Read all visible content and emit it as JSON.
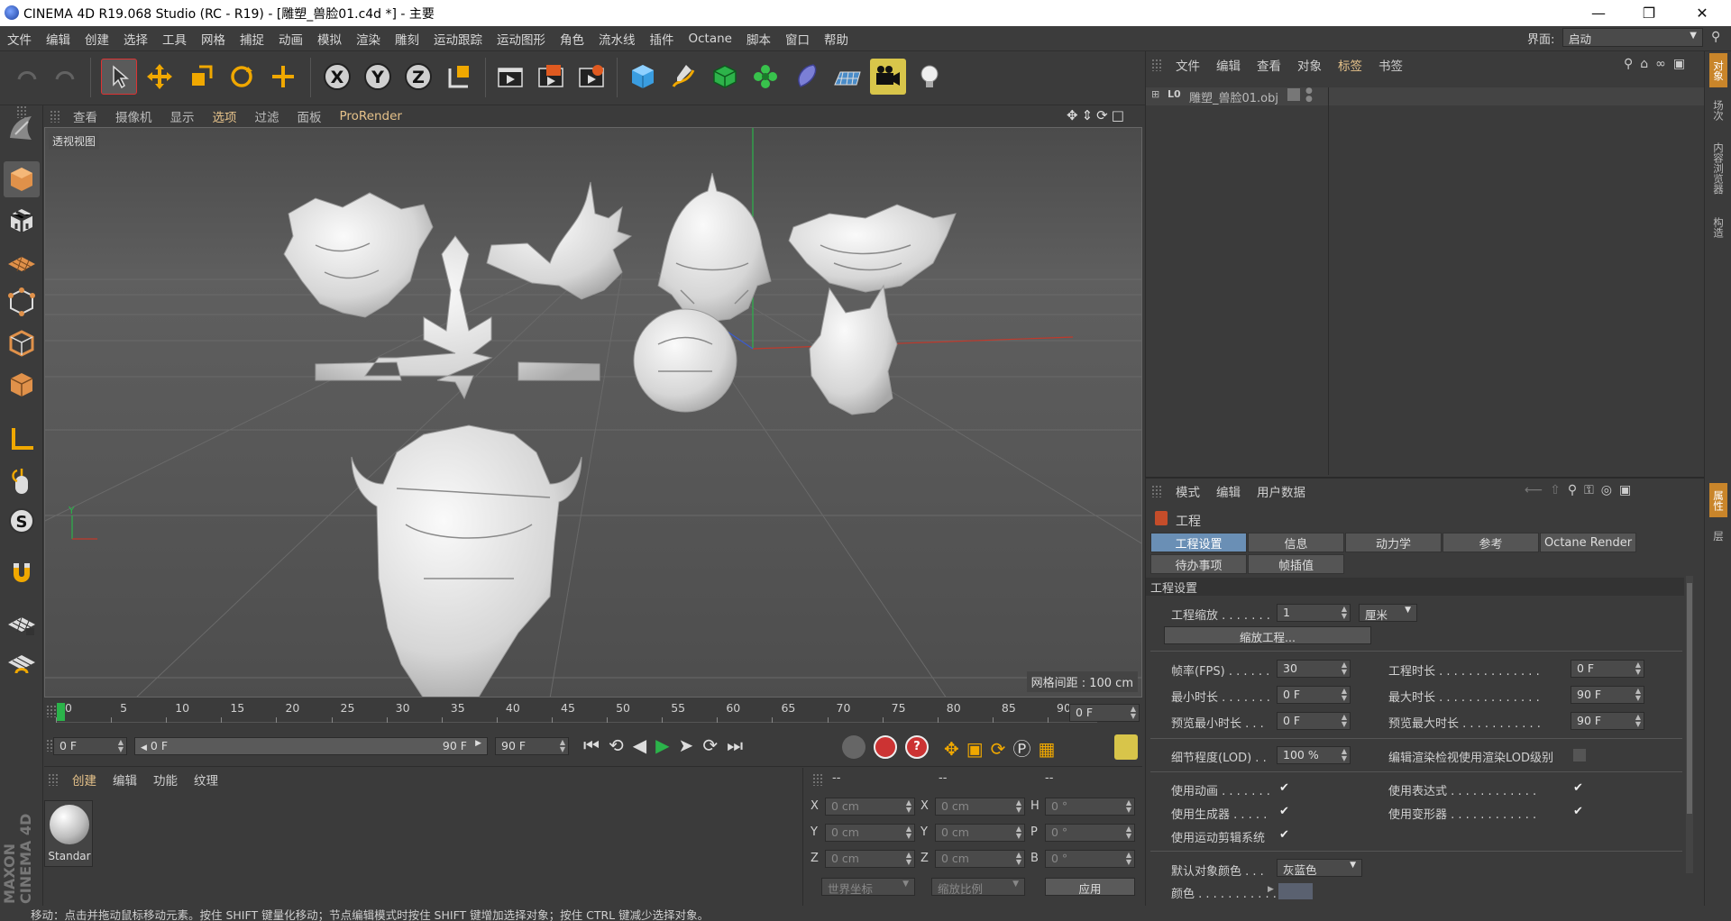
{
  "window": {
    "title": "CINEMA 4D R19.068 Studio (RC - R19) - [雕塑_兽脸01.c4d *] - 主要"
  },
  "menubar": {
    "items": [
      "文件",
      "编辑",
      "创建",
      "选择",
      "工具",
      "网格",
      "捕捉",
      "动画",
      "模拟",
      "渲染",
      "雕刻",
      "运动跟踪",
      "运动图形",
      "角色",
      "流水线",
      "插件",
      "Octane",
      "脚本",
      "窗口",
      "帮助"
    ],
    "layout_label": "界面:",
    "layout_value": "启动"
  },
  "viewport": {
    "menu": [
      "查看",
      "摄像机",
      "显示",
      "选项",
      "过滤",
      "面板",
      "ProRender"
    ],
    "label": "透视视图",
    "grid_note": "网格间距 : 100 cm"
  },
  "timeline": {
    "ticks": [
      "0",
      "5",
      "10",
      "15",
      "20",
      "25",
      "30",
      "35",
      "40",
      "45",
      "50",
      "55",
      "60",
      "65",
      "70",
      "75",
      "80",
      "85",
      "90"
    ],
    "current_frame": "0 F"
  },
  "transport": {
    "start": "0 F",
    "range_start": "0 F",
    "range_end": "90 F",
    "end": "90 F"
  },
  "materials": {
    "menu": [
      "创建",
      "编辑",
      "功能",
      "纹理"
    ],
    "items": [
      {
        "name": "Standar"
      }
    ]
  },
  "coords": {
    "headers": [
      "--",
      "--",
      "--"
    ],
    "rows": [
      {
        "a": "X",
        "v1": "0 cm",
        "b": "X",
        "v2": "0 cm",
        "c": "H",
        "v3": "0 °"
      },
      {
        "a": "Y",
        "v1": "0 cm",
        "b": "Y",
        "v2": "0 cm",
        "c": "P",
        "v3": "0 °"
      },
      {
        "a": "Z",
        "v1": "0 cm",
        "b": "Z",
        "v2": "0 cm",
        "c": "B",
        "v3": "0 °"
      }
    ],
    "world": "世界坐标",
    "scale": "缩放比例",
    "apply": "应用"
  },
  "objects": {
    "menu": [
      "文件",
      "编辑",
      "查看",
      "对象",
      "标签",
      "书签"
    ],
    "items": [
      {
        "name": "雕塑_兽脸01.obj",
        "icon": "L0"
      }
    ]
  },
  "attributes": {
    "menu": [
      "模式",
      "编辑",
      "用户数据"
    ],
    "title": "工程",
    "tabs_row1": [
      "工程设置",
      "信息",
      "动力学",
      "参考",
      "Octane Render"
    ],
    "tabs_row2": [
      "待办事项",
      "帧插值"
    ],
    "section": "工程设置",
    "scale_label": "工程缩放 . . . . . . .",
    "scale_value": "1",
    "scale_unit": "厘米",
    "scale_button": "缩放工程...",
    "fps_label": "帧率(FPS) . . . . . .",
    "fps": "30",
    "length_label": "工程时长 . . . . . . . . . . . . . .",
    "length": "0 F",
    "min_label": "最小时长 . . . . . . .",
    "min": "0 F",
    "max_label": "最大时长 . . . . . . . . . . . . . .",
    "max": "90 F",
    "pmin_label": "预览最小时长 . . .",
    "pmin": "0 F",
    "pmax_label": "预览最大时长 . . . . . . . . . . .",
    "pmax": "90 F",
    "lod_label": "细节程度(LOD) . .",
    "lod": "100 %",
    "lodrender_label": "编辑渲染检视使用渲染LOD级别",
    "use_anim": "使用动画 . . . . . . .",
    "use_expr": "使用表达式 . . . . . . . . . . . .",
    "use_gen": "使用生成器 . . . . .",
    "use_deform": "使用变形器 . . . . . . . . . . . .",
    "use_motion": "使用运动剪辑系统",
    "objcolor_label": "默认对象颜色 . . .",
    "objcolor": "灰蓝色",
    "color_label": "颜色 . . . . . . . . . . . ."
  },
  "right_tabs": [
    "对象",
    "场次",
    "内容浏览器",
    "构造"
  ],
  "right_tabs2": [
    "属性",
    "层"
  ],
  "status": "移动：点击并拖动鼠标移动元素。按住 SHIFT 键量化移动；节点编辑模式时按住 SHIFT 键增加选择对象；按住 CTRL 键减少选择对象。",
  "side_brand": "MAXON CINEMA 4D"
}
